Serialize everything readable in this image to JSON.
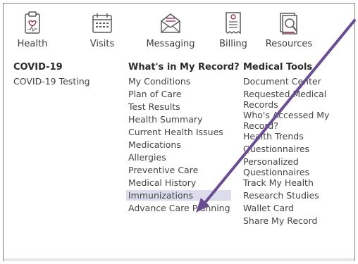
{
  "nav": {
    "items": [
      {
        "label": "Health",
        "icon": "health-clipboard-icon"
      },
      {
        "label": "Visits",
        "icon": "calendar-icon"
      },
      {
        "label": "Messaging",
        "icon": "envelope-icon"
      },
      {
        "label": "Billing",
        "icon": "bill-icon"
      },
      {
        "label": "Resources",
        "icon": "document-search-icon"
      }
    ]
  },
  "covid": {
    "title": "COVID-19",
    "items": [
      "COVID-19 Testing"
    ]
  },
  "record": {
    "title": "What's in My Record?",
    "items": [
      "My Conditions",
      "Plan of Care",
      "Test Results",
      "Health Summary",
      "Current Health Issues",
      "Medications",
      "Allergies",
      "Preventive Care",
      "Medical History",
      "Immunizations",
      "Advance Care Planning"
    ],
    "highlighted": "Immunizations"
  },
  "tools": {
    "title": "Medical Tools",
    "items": [
      "Document Center",
      "Requested Medical Records",
      "Who's Accessed My Record?",
      "Health Trends",
      "Questionnaires",
      "Personalized Questionnaires",
      "Track My Health",
      "Research Studies",
      "Wallet Card",
      "Share My Record"
    ]
  },
  "annotation": {
    "arrow_color": "#6a4c93"
  }
}
